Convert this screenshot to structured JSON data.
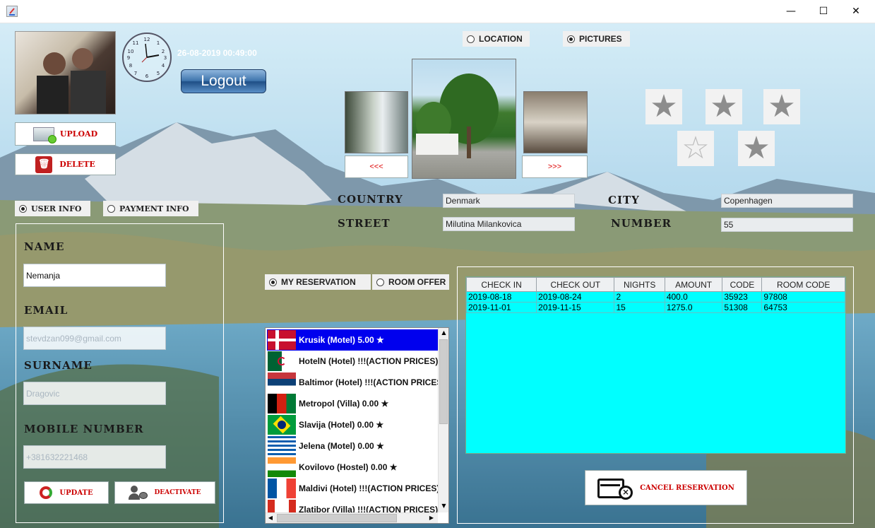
{
  "window": {
    "minimize": "—",
    "maximize": "☐",
    "close": "✕"
  },
  "datetime": "26-08-2019 00:49:00",
  "logout_label": "Logout",
  "upload_label": "Upload",
  "delete_label": "Delete",
  "view_toggle": {
    "location": "LOCATION",
    "pictures": "PICTURES",
    "selected": "pictures"
  },
  "gallery": {
    "prev": "<<<",
    "next": ">>>"
  },
  "info_toggle": {
    "user": "User info",
    "payment": "Payment info",
    "selected": "user"
  },
  "user": {
    "name_label": "Name",
    "name": "Nemanja",
    "email_label": "Email",
    "email": "stevdzan099@gmail.com",
    "surname_label": "Surname",
    "surname": "Dragovic",
    "mobile_label": "Mobile number",
    "mobile": "+381632221468",
    "update_label": "Update",
    "deactivate_label": "Deactivate"
  },
  "location": {
    "country_label": "Country",
    "country": "Denmark",
    "city_label": "City",
    "city": "Copenhagen",
    "street_label": "Street",
    "street": "Milutina Milankovica",
    "number_label": "Number",
    "number": "55"
  },
  "stars": {
    "rating": "5 stars"
  },
  "res_toggle": {
    "mine": "MY RESERVATION",
    "offer": "ROOM OFFER",
    "selected": "mine"
  },
  "hotels": [
    {
      "label": "Krusik (Motel)        5.00 ★",
      "flag": "denmark",
      "selected": true
    },
    {
      "label": "HotelN (Hotel)  !!!(ACTION PRICES)!!!",
      "flag": "algeria"
    },
    {
      "label": "Baltimor (Hotel)  !!!(ACTION PRICES",
      "flag": "serbia"
    },
    {
      "label": "Metropol (Villa)       0.00 ★",
      "flag": "afghanistan"
    },
    {
      "label": "Slavija (Hotel)        0.00 ★",
      "flag": "brazil"
    },
    {
      "label": "Jelena (Motel)         0.00 ★",
      "flag": "greece"
    },
    {
      "label": "Kovilovo (Hostel)       0.00 ★",
      "flag": "india"
    },
    {
      "label": "Maldivi (Hotel)  !!!(ACTION PRICES)!!!",
      "flag": "france"
    },
    {
      "label": "Zlatibor (Villa)  !!!(ACTION PRICES)!!!",
      "flag": "canada"
    }
  ],
  "reservations": {
    "columns": [
      "CHECK IN",
      "CHECK OUT",
      "NIGHTS",
      "AMOUNT",
      "CODE",
      "ROOM CODE"
    ],
    "rows": [
      [
        "2019-08-18",
        "2019-08-24",
        "2",
        "400.0",
        "35923",
        "97808"
      ],
      [
        "2019-11-01",
        "2019-11-15",
        "15",
        "1275.0",
        "51308",
        "64753"
      ]
    ]
  },
  "cancel_label": "Cancel reservation",
  "colors": {
    "accent_red": "#cc0000",
    "table_bg": "#00ffff",
    "list_selected": "#0000ee"
  }
}
